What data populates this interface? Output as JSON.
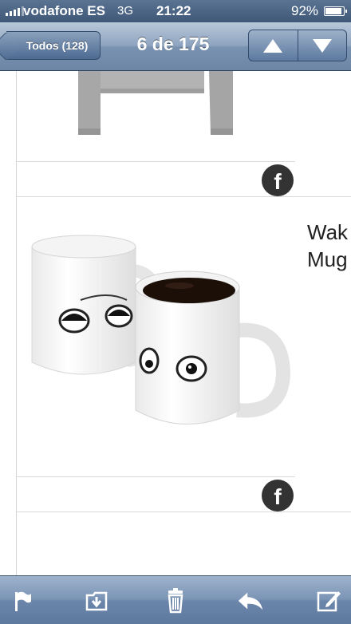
{
  "status_bar": {
    "carrier": "vodafone ES",
    "network": "3G",
    "time": "21:22",
    "battery": "92%"
  },
  "nav": {
    "back_label": "Todos (128)",
    "title": "6 de 175",
    "prev_icon": "arrow-up-icon",
    "next_icon": "arrow-down-icon"
  },
  "content": {
    "products": [
      {
        "image": "grey sweater",
        "share_icon": "facebook-icon"
      },
      {
        "image": "white mugs with eyes",
        "text": "Wak\nMug",
        "share_icon": "facebook-icon"
      }
    ],
    "fb_glyph": "f"
  },
  "toolbar": {
    "buttons": [
      "flag-icon",
      "move-to-folder-icon",
      "trash-icon",
      "reply-icon",
      "compose-icon"
    ]
  }
}
